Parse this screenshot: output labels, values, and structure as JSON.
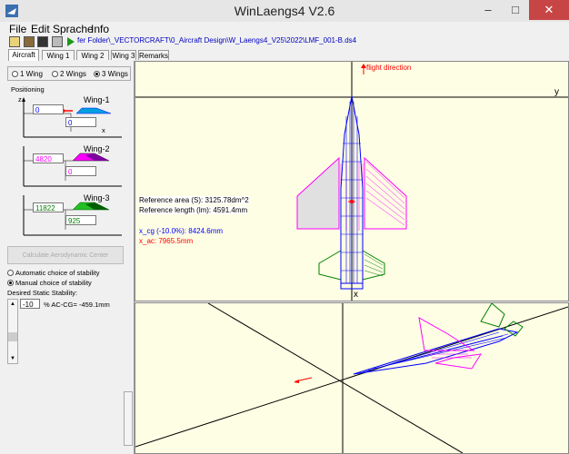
{
  "window": {
    "title": "WinLaengs4  V2.6",
    "min": "–",
    "max": "□",
    "close": "✕"
  },
  "menu": [
    "File",
    "Edit",
    "Sprache",
    "Info"
  ],
  "toolbar": {
    "path": "fer Folder\\_VECTORCRAFT\\0_Aircraft Design\\W_Laengs4_V25\\2022\\LMF_001-B.ds4"
  },
  "tabs": [
    "Aircraft",
    "Wing 1",
    "Wing 2",
    "Wing 3",
    "Remarks"
  ],
  "wings_count": {
    "options": [
      "1 Wing",
      "2 Wings",
      "3 Wings"
    ],
    "selected": "3 Wings"
  },
  "positioning": {
    "label": "Positioning",
    "z_label": "z",
    "x_label": "x",
    "wings": [
      {
        "name": "Wing-1",
        "z": "0",
        "x": "0",
        "color": "#0000ff"
      },
      {
        "name": "Wing-2",
        "z": "4820",
        "x": "0",
        "color": "#ff00ff"
      },
      {
        "name": "Wing-3",
        "z": "11822",
        "x": "925",
        "color": "#008000"
      }
    ]
  },
  "calc_button": "Calculate Aerodynamic Center",
  "stability": {
    "options": [
      "Automatic choice of stability",
      "Manual choice of stability"
    ],
    "selected": "Manual choice of stability",
    "desired_label": "Desired Static Stability:",
    "value": "-10",
    "unit_text": "% AC-CG= -459.1mm"
  },
  "top_view": {
    "flight_direction": "flight direction",
    "axis_y": "y",
    "axis_x": "x",
    "ref_area": "Reference area (S): 3125.78dm^2",
    "ref_length": "Reference length (lm): 4591.4mm",
    "x_cg": "x_cg (-10.0%): 8424.6mm",
    "x_ac": "x_ac: 7965.5mm",
    "x_cg_color": "#0000ff",
    "x_ac_color": "#ff0000"
  }
}
